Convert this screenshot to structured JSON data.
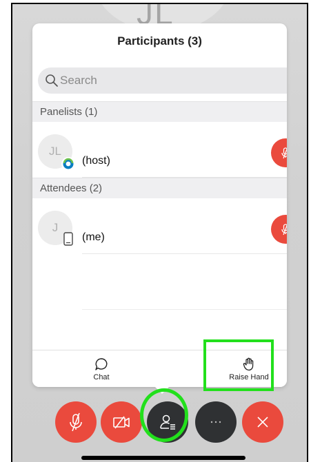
{
  "panel": {
    "title": "Participants (3)",
    "search_placeholder": "Search"
  },
  "background": {
    "initials": "JL"
  },
  "sections": {
    "panelists_label": "Panelists (1)",
    "attendees_label": "Attendees (2)"
  },
  "participants": [
    {
      "initials": "JL",
      "label": "(host)",
      "badge": "webex-app-icon",
      "muted": true
    },
    {
      "initials": "J",
      "label": "(me)",
      "badge": "mobile-device-icon",
      "muted": true
    }
  ],
  "bottom_bar": {
    "chat_label": "Chat",
    "raise_hand_label": "Raise Hand"
  },
  "controls": [
    "mute-mic-icon",
    "video-off-icon",
    "participants-icon",
    "more-icon",
    "leave-icon"
  ],
  "colors": {
    "red": "#ea4a3d",
    "dark": "#2f3133",
    "highlight": "#22e01c"
  }
}
